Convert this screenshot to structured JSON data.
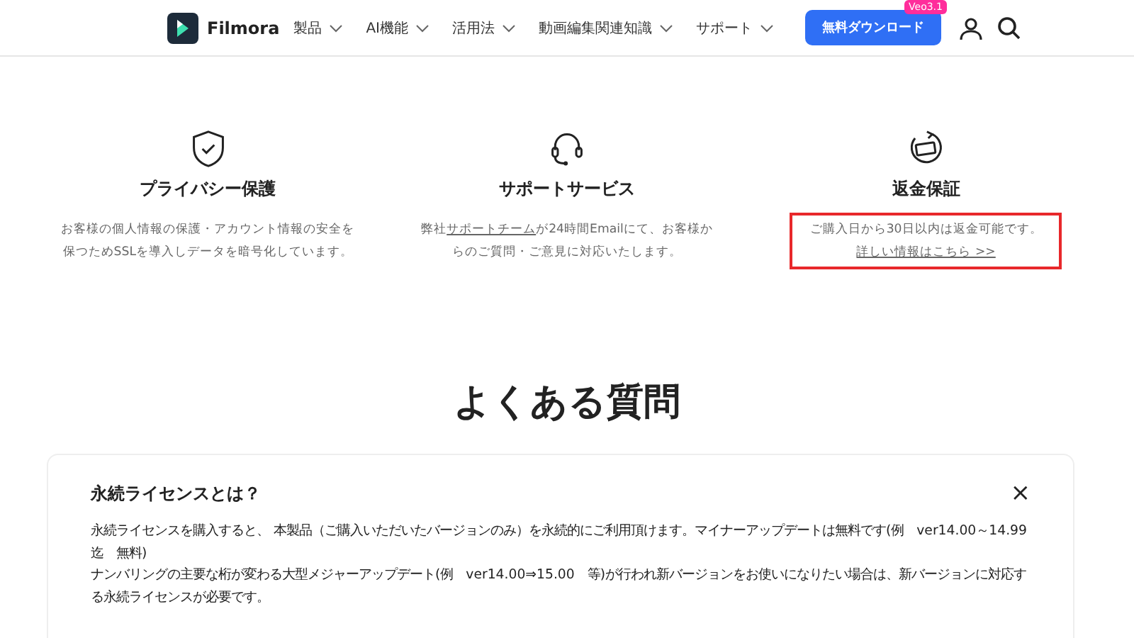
{
  "nav": {
    "brand": "Filmora",
    "menus": [
      "製品",
      "AI機能",
      "活用法",
      "動画編集関連知識",
      "サポート"
    ],
    "download": "無料ダウンロード",
    "badge": "Veo3.1"
  },
  "features": [
    {
      "kind": "shield",
      "title": "プライバシー保護",
      "lines": [
        "お客様の個人情報の保護・アカウント情報の安全を",
        "保つためSSLを導入しデータを暗号化しています。"
      ],
      "highlighted": false
    },
    {
      "kind": "headset",
      "title": "サポートサービス",
      "pre": "弊社",
      "link": "サポートチーム",
      "post": "が24時間Emailにて、お客様か",
      "line2": "らのご質問・ご意見に対応いたします。",
      "highlighted": false
    },
    {
      "kind": "refund",
      "title": "返金保証",
      "lines": [
        "ご購入日から30日以内は返金可能です。"
      ],
      "more": "詳しい情報はこちら >>",
      "highlighted": true
    }
  ],
  "faq_heading": "よくある質問",
  "faq": {
    "question": "永続ライセンスとは？",
    "expanded": true,
    "close": "×",
    "answer": [
      "永続ライセンスを購入すると、 本製品（ご購入いただいたバージョンのみ）を永続的にご利用頂けます。マイナーアップデートは無料です(例　ver14.00～14.99　迄　無料)",
      "ナンバリングの主要な桁が変わる大型メジャーアップデート(例　ver14.00⇒15.00　等)が行われ新バージョンをお使いになりたい場合は、新バージョンに対応する永続ライセンスが必要です。"
    ]
  }
}
